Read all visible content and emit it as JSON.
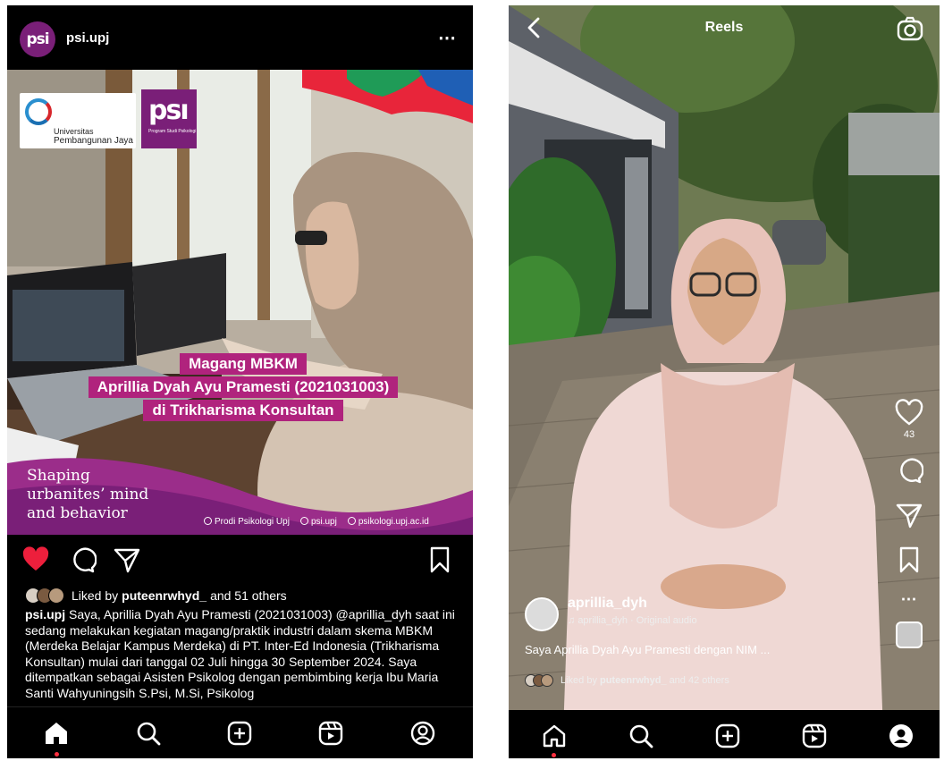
{
  "post": {
    "username": "psi.upj",
    "avatar_text": "psi",
    "more_icon": "⋯",
    "image": {
      "upj_line1": "Universitas",
      "upj_line2": "Pembangunan Jaya",
      "psi_logo_text": "psı",
      "psi_logo_sub": "Program Studi Psikologi",
      "banner_line1": "Magang MBKM",
      "banner_line2": "Aprillia Dyah Ayu Pramesti (2021031003)",
      "banner_line3": "di Trikharisma Konsultan",
      "tagline_line1": "Shaping",
      "tagline_line2": "urbanites’ mind",
      "tagline_line3": "and behavior",
      "footer_fb": "Prodi Psikologi Upj",
      "footer_ig": "psi.upj",
      "footer_web": "psikologi.upj.ac.id"
    },
    "liked_prefix": "Liked by",
    "liked_user": "puteenrwhyd_",
    "liked_suffix": "and 51 others",
    "caption_user": "psi.upj",
    "caption_body": "Saya, Aprillia Dyah Ayu Pramesti (2021031003) @aprillia_dyh saat ini sedang melakukan kegiatan magang/praktik industri dalam skema MBKM (Merdeka Belajar Kampus Merdeka) di PT. Inter-Ed Indonesia (Trikharisma Konsultan) mulai dari tanggal 02 Juli hingga 30 September 2024. Saya ditempatkan sebagai Asisten Psikolog dengan pembimbing kerja Ibu Maria Santi Wahyuningsih S.Psi, M.Si, Psikolog",
    "colors": {
      "like": "#ed1f3c",
      "brand": "#7a1f78",
      "banner": "#b0237d"
    }
  },
  "reel": {
    "title": "Reels",
    "like_count": "43",
    "username": "aprillia_dyh",
    "audio": "aprillia_dyh · Original audio",
    "caption": "Saya Aprillia Dyah Ayu Pramesti dengan NIM ...",
    "liked_prefix": "Liked by",
    "liked_user": "puteenrwhyd_",
    "liked_suffix": "and 42 others",
    "more_icon": "⋯"
  },
  "icons": {
    "left_nav": [
      "home-icon",
      "search-icon",
      "create-icon",
      "reels-icon",
      "profile-icon"
    ],
    "post_actions": [
      "heart-filled-icon",
      "comment-icon",
      "share-icon",
      "bookmark-icon"
    ],
    "reel_actions": [
      "heart-icon",
      "comment-icon",
      "share-icon",
      "bookmark-icon",
      "more-icon",
      "audio-icon"
    ]
  }
}
